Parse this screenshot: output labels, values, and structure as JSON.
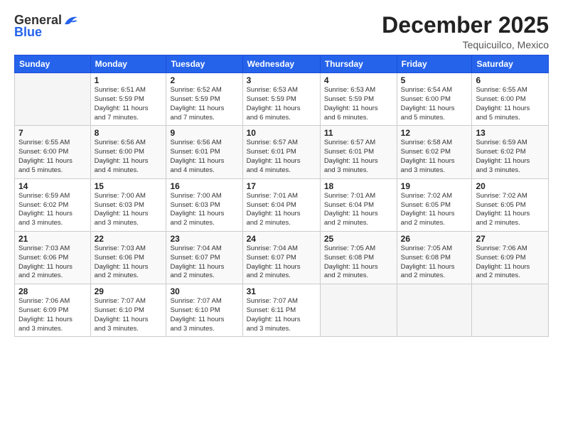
{
  "logo": {
    "general": "General",
    "blue": "Blue"
  },
  "header": {
    "month": "December 2025",
    "location": "Tequicuilco, Mexico"
  },
  "weekdays": [
    "Sunday",
    "Monday",
    "Tuesday",
    "Wednesday",
    "Thursday",
    "Friday",
    "Saturday"
  ],
  "weeks": [
    [
      {
        "day": "",
        "info": ""
      },
      {
        "day": "1",
        "info": "Sunrise: 6:51 AM\nSunset: 5:59 PM\nDaylight: 11 hours\nand 7 minutes."
      },
      {
        "day": "2",
        "info": "Sunrise: 6:52 AM\nSunset: 5:59 PM\nDaylight: 11 hours\nand 7 minutes."
      },
      {
        "day": "3",
        "info": "Sunrise: 6:53 AM\nSunset: 5:59 PM\nDaylight: 11 hours\nand 6 minutes."
      },
      {
        "day": "4",
        "info": "Sunrise: 6:53 AM\nSunset: 5:59 PM\nDaylight: 11 hours\nand 6 minutes."
      },
      {
        "day": "5",
        "info": "Sunrise: 6:54 AM\nSunset: 6:00 PM\nDaylight: 11 hours\nand 5 minutes."
      },
      {
        "day": "6",
        "info": "Sunrise: 6:55 AM\nSunset: 6:00 PM\nDaylight: 11 hours\nand 5 minutes."
      }
    ],
    [
      {
        "day": "7",
        "info": "Sunrise: 6:55 AM\nSunset: 6:00 PM\nDaylight: 11 hours\nand 5 minutes."
      },
      {
        "day": "8",
        "info": "Sunrise: 6:56 AM\nSunset: 6:00 PM\nDaylight: 11 hours\nand 4 minutes."
      },
      {
        "day": "9",
        "info": "Sunrise: 6:56 AM\nSunset: 6:01 PM\nDaylight: 11 hours\nand 4 minutes."
      },
      {
        "day": "10",
        "info": "Sunrise: 6:57 AM\nSunset: 6:01 PM\nDaylight: 11 hours\nand 4 minutes."
      },
      {
        "day": "11",
        "info": "Sunrise: 6:57 AM\nSunset: 6:01 PM\nDaylight: 11 hours\nand 3 minutes."
      },
      {
        "day": "12",
        "info": "Sunrise: 6:58 AM\nSunset: 6:02 PM\nDaylight: 11 hours\nand 3 minutes."
      },
      {
        "day": "13",
        "info": "Sunrise: 6:59 AM\nSunset: 6:02 PM\nDaylight: 11 hours\nand 3 minutes."
      }
    ],
    [
      {
        "day": "14",
        "info": "Sunrise: 6:59 AM\nSunset: 6:02 PM\nDaylight: 11 hours\nand 3 minutes."
      },
      {
        "day": "15",
        "info": "Sunrise: 7:00 AM\nSunset: 6:03 PM\nDaylight: 11 hours\nand 3 minutes."
      },
      {
        "day": "16",
        "info": "Sunrise: 7:00 AM\nSunset: 6:03 PM\nDaylight: 11 hours\nand 2 minutes."
      },
      {
        "day": "17",
        "info": "Sunrise: 7:01 AM\nSunset: 6:04 PM\nDaylight: 11 hours\nand 2 minutes."
      },
      {
        "day": "18",
        "info": "Sunrise: 7:01 AM\nSunset: 6:04 PM\nDaylight: 11 hours\nand 2 minutes."
      },
      {
        "day": "19",
        "info": "Sunrise: 7:02 AM\nSunset: 6:05 PM\nDaylight: 11 hours\nand 2 minutes."
      },
      {
        "day": "20",
        "info": "Sunrise: 7:02 AM\nSunset: 6:05 PM\nDaylight: 11 hours\nand 2 minutes."
      }
    ],
    [
      {
        "day": "21",
        "info": "Sunrise: 7:03 AM\nSunset: 6:06 PM\nDaylight: 11 hours\nand 2 minutes."
      },
      {
        "day": "22",
        "info": "Sunrise: 7:03 AM\nSunset: 6:06 PM\nDaylight: 11 hours\nand 2 minutes."
      },
      {
        "day": "23",
        "info": "Sunrise: 7:04 AM\nSunset: 6:07 PM\nDaylight: 11 hours\nand 2 minutes."
      },
      {
        "day": "24",
        "info": "Sunrise: 7:04 AM\nSunset: 6:07 PM\nDaylight: 11 hours\nand 2 minutes."
      },
      {
        "day": "25",
        "info": "Sunrise: 7:05 AM\nSunset: 6:08 PM\nDaylight: 11 hours\nand 2 minutes."
      },
      {
        "day": "26",
        "info": "Sunrise: 7:05 AM\nSunset: 6:08 PM\nDaylight: 11 hours\nand 2 minutes."
      },
      {
        "day": "27",
        "info": "Sunrise: 7:06 AM\nSunset: 6:09 PM\nDaylight: 11 hours\nand 2 minutes."
      }
    ],
    [
      {
        "day": "28",
        "info": "Sunrise: 7:06 AM\nSunset: 6:09 PM\nDaylight: 11 hours\nand 3 minutes."
      },
      {
        "day": "29",
        "info": "Sunrise: 7:07 AM\nSunset: 6:10 PM\nDaylight: 11 hours\nand 3 minutes."
      },
      {
        "day": "30",
        "info": "Sunrise: 7:07 AM\nSunset: 6:10 PM\nDaylight: 11 hours\nand 3 minutes."
      },
      {
        "day": "31",
        "info": "Sunrise: 7:07 AM\nSunset: 6:11 PM\nDaylight: 11 hours\nand 3 minutes."
      },
      {
        "day": "",
        "info": ""
      },
      {
        "day": "",
        "info": ""
      },
      {
        "day": "",
        "info": ""
      }
    ]
  ]
}
